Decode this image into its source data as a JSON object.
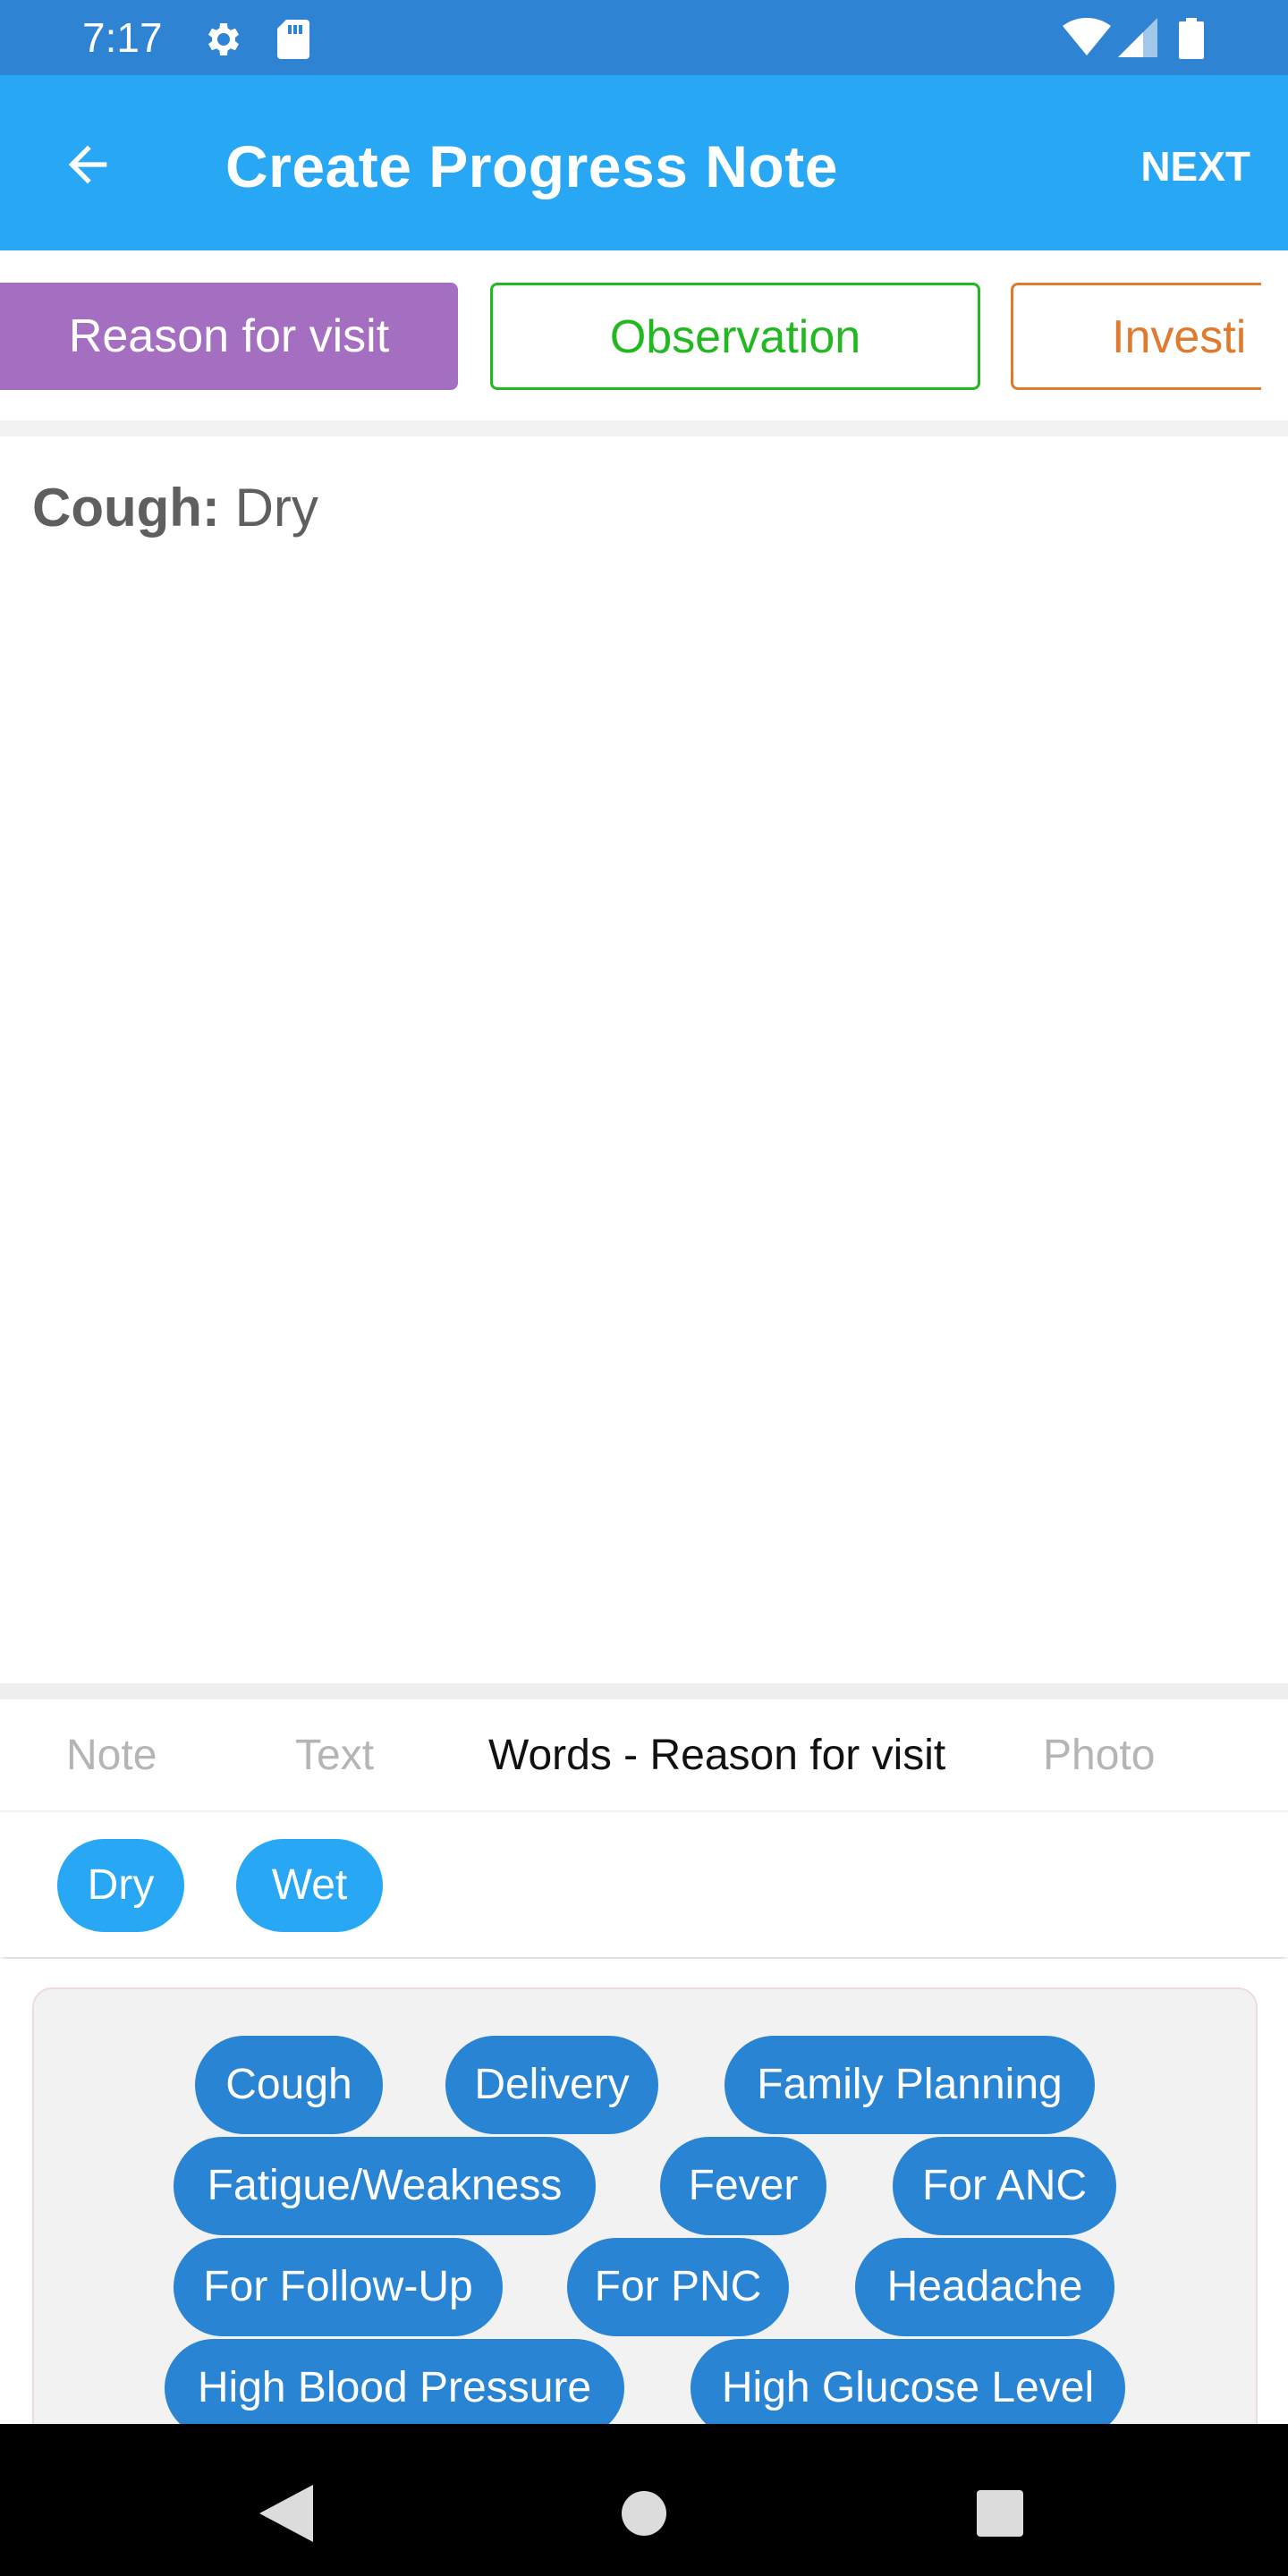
{
  "status_bar": {
    "time": "7:17",
    "icons": [
      "settings-icon",
      "sd-card-icon",
      "wifi-icon",
      "cellular-signal-icon",
      "battery-icon"
    ]
  },
  "app_bar": {
    "title": "Create Progress Note",
    "back_icon": "arrow-back-icon",
    "next_label": "NEXT"
  },
  "section_tabs": [
    {
      "label": "Reason for visit",
      "selected": true,
      "color": "#a56fc1"
    },
    {
      "label": "Observation",
      "selected": false,
      "color": "#22b822"
    },
    {
      "label": "Investi",
      "selected": false,
      "color": "#e07a2e"
    }
  ],
  "note_entry": {
    "key": "Cough:",
    "value": " Dry"
  },
  "mode_tabs": [
    {
      "label": "Note",
      "active": false
    },
    {
      "label": "Text",
      "active": false
    },
    {
      "label": "Words - Reason for visit",
      "active": true
    },
    {
      "label": "Photo",
      "active": false
    }
  ],
  "sub_options": [
    "Dry",
    "Wet"
  ],
  "words": [
    "Cough",
    "Delivery",
    "Family Planning",
    "Fatigue/Weakness",
    "Fever",
    "For ANC",
    "For Follow-Up",
    "For PNC",
    "Headache",
    "High Blood Pressure",
    "High Glucose Level"
  ],
  "nav_bar": {
    "icons": [
      "back-triangle-icon",
      "home-circle-icon",
      "recents-square-icon"
    ]
  },
  "colors": {
    "status_bar": "#2f83d3",
    "app_bar": "#27a7f4",
    "chip_light": "#27a7f4",
    "chip_dark": "#2a84d4"
  }
}
